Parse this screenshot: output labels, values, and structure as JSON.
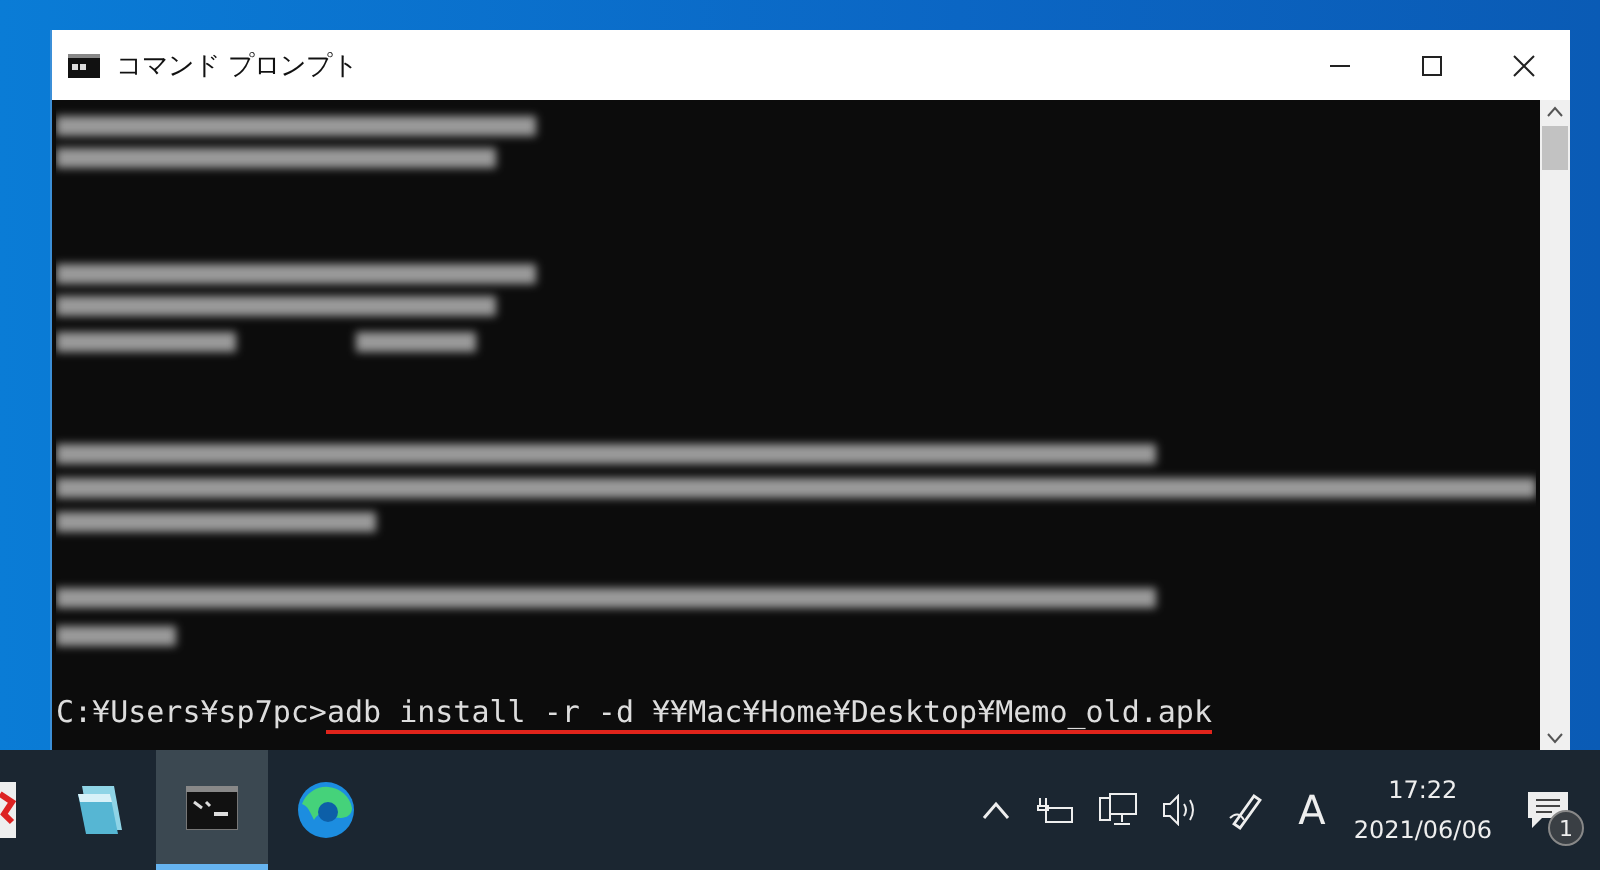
{
  "window": {
    "title": "コマンド プロンプト"
  },
  "console": {
    "prompt": "C:¥Users¥sp7pc>",
    "command": "adb install -r -d ¥¥Mac¥Home¥Desktop¥Memo_old.apk",
    "command_underlined": true
  },
  "taskbar": {
    "apps": [
      {
        "kind": "red-app",
        "selected": false
      },
      {
        "kind": "notepad",
        "selected": false
      },
      {
        "kind": "terminal",
        "selected": true
      },
      {
        "kind": "browser",
        "selected": false
      }
    ],
    "ime": "A",
    "time": "17:22",
    "date": "2021/06/06",
    "notification_count": "1"
  }
}
